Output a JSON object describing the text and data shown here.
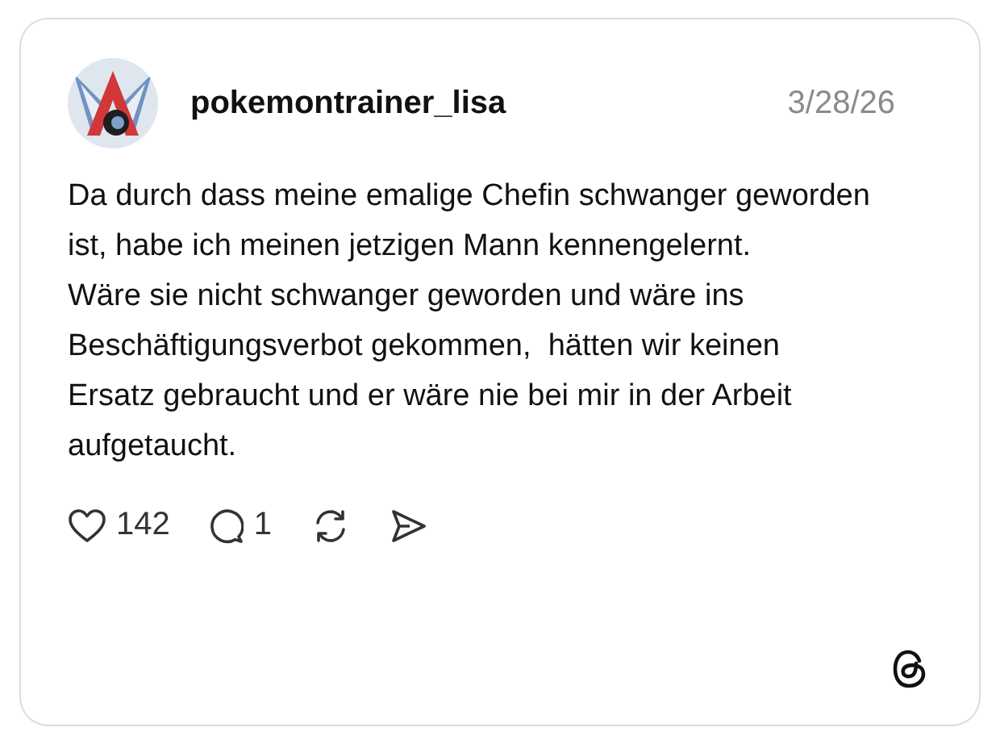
{
  "post": {
    "username": "pokemontrainer_lisa",
    "date": "3/28/26",
    "paragraphs": [
      "Da durch dass meine emalige Chefin schwanger geworden ist, habe ich meinen jetzigen Mann kennengelernt.",
      "Wäre sie nicht schwanger geworden und wäre ins Beschäftigungsverbot gekommen,  hätten wir keinen Ersatz gebraucht und er wäre nie bei mir in der Arbeit aufgetaucht."
    ],
    "actions": [
      {
        "kind": "like",
        "count": "142"
      },
      {
        "kind": "reply",
        "count": "1"
      },
      {
        "kind": "repost"
      },
      {
        "kind": "share"
      }
    ]
  }
}
